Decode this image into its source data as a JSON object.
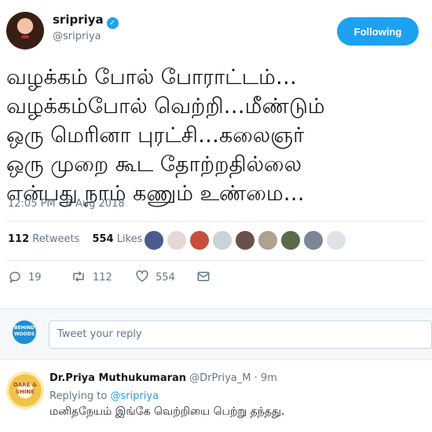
{
  "author": {
    "name": "sripriya",
    "handle": "@sripriya",
    "follow_label": "Following"
  },
  "tweet": {
    "text": "வழக்கம் போல் போராட்டம்…\nவழக்கம்போல் வெற்றி…மீண்டும்\nஒரு மெரினா புரட்சி…கலைஞர்\nஒரு முறை கூட தோற்றதில்லை\nஎன்பது நாம் கணும் உண்மை…",
    "timestamp": "12:05 PM - 8 Aug 2018"
  },
  "stats": {
    "retweets_count": "112",
    "retweets_label": "Retweets",
    "likes_count": "554",
    "likes_label": "Likes"
  },
  "liker_avatar_colors": [
    "#4b5a8c",
    "#e8d7d7",
    "#c6503c",
    "#c9d3db",
    "#6a5048",
    "#b0a090",
    "#5c6a4c",
    "#7d8696",
    "#dfe3e8"
  ],
  "actions": {
    "reply_count": "19",
    "retweet_count": "112",
    "like_count": "554"
  },
  "reply_box": {
    "logo_text": "BEHIND WOODS",
    "placeholder": "Tweet your reply"
  },
  "reply": {
    "avatar_text": "DARE & SHINE",
    "name": "Dr.Priya Muthukumaran",
    "handle": "@DrPriya_M",
    "time": "· 9m",
    "replying_prefix": "Replying to",
    "replying_to": "@sripriya",
    "text": "மனிதநேயம் இங்கே வெற்றியை பெற்று தந்தது."
  },
  "colors": {
    "accent": "#1da1f2",
    "muted": "#657786",
    "text": "#14171a"
  }
}
